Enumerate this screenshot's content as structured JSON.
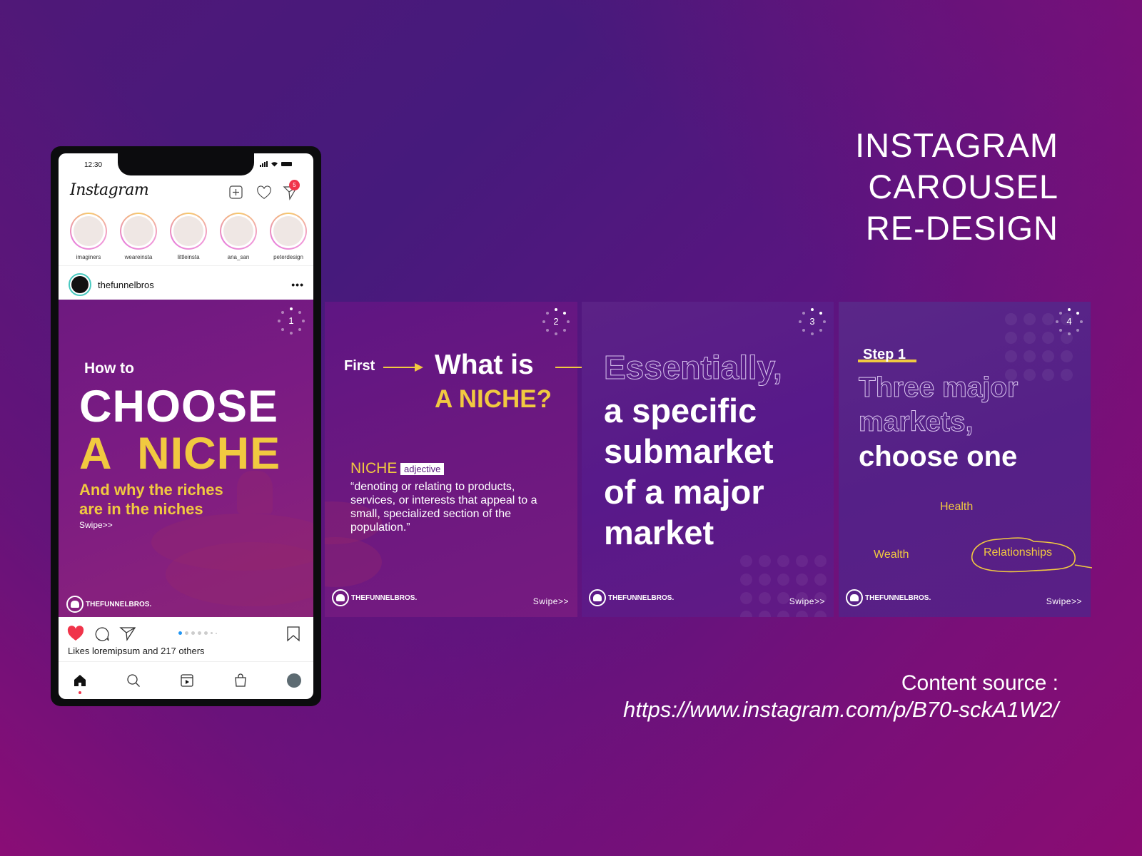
{
  "title": {
    "lines": [
      "INSTAGRAM",
      "CAROUSEL",
      "RE-DESIGN"
    ]
  },
  "source": {
    "label": "Content source :",
    "url": "https://www.instagram.com/p/B70-sckA1W2/"
  },
  "phone": {
    "status_time": "12:30",
    "app_name": "Instagram",
    "header_icons": [
      "new-post-icon",
      "heart-icon",
      "direct-message-icon"
    ],
    "notification_count": "5",
    "stories": [
      {
        "name": "imaginers"
      },
      {
        "name": "weareinsta"
      },
      {
        "name": "littleinsta"
      },
      {
        "name": "ana_san"
      },
      {
        "name": "peterdesign"
      }
    ],
    "post": {
      "username": "thefunnelbros",
      "more": "•••",
      "likes_prefix": "Likes",
      "likes_user": "loremipsum",
      "likes_suffix": "and 217 others",
      "carousel_position": 1,
      "carousel_total": 7
    },
    "nav": [
      "home-icon",
      "search-icon",
      "reels-icon",
      "shop-icon",
      "profile-avatar"
    ]
  },
  "brand": {
    "name": "THEFUNNELBROS.",
    "swipe": "Swipe>>"
  },
  "slides": [
    {
      "number": "1",
      "howto": "How to",
      "headline1": "CHOOSE",
      "headline2": "A  NICHE",
      "subtitle1": "And why the riches",
      "subtitle2": "are in the niches",
      "swipe": "Swipe>>"
    },
    {
      "number": "2",
      "first": "First",
      "question1": "What is",
      "question2": "A NICHE?",
      "term": "NICHE",
      "part_of_speech": "adjective",
      "definition": "“denoting or relating to products, services, or interests that appeal to a small, specialized section of the population.”"
    },
    {
      "number": "3",
      "lead": "Essentially,",
      "body": [
        "a specific",
        "submarket",
        "of a major",
        "market"
      ]
    },
    {
      "number": "4",
      "step": "Step 1",
      "outline": [
        "Three major",
        "markets,"
      ],
      "choose": "choose one",
      "markets": [
        "Health",
        "Wealth",
        "Relationships"
      ],
      "selected_market": "Relationships"
    }
  ],
  "colors": {
    "accent_yellow": "#f1c940",
    "like_red": "#f0344a",
    "dot_active": "#2196f3"
  }
}
